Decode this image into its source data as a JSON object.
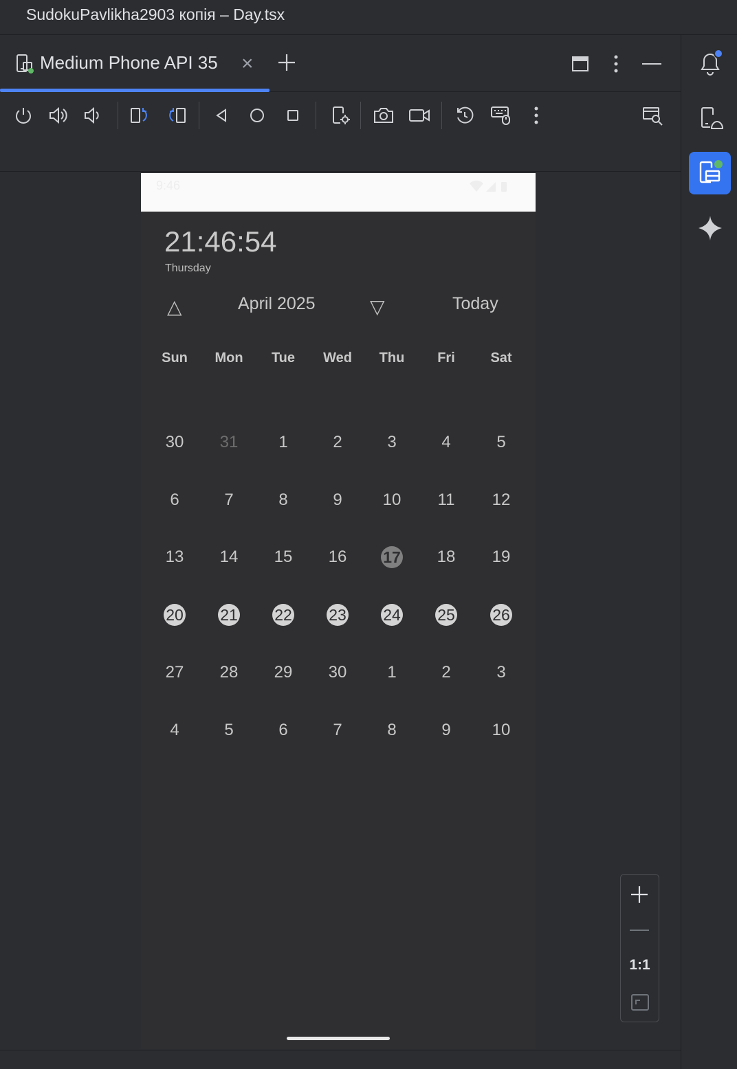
{
  "window": {
    "title": "SudokuPavlikha2903 копія – Day.tsx"
  },
  "tabs": [
    {
      "label": "Medium Phone API 35",
      "close": "×"
    }
  ],
  "phone": {
    "status_time": "9:46",
    "clock": "21:46:54",
    "weekday": "Thursday",
    "prev_symbol": "△",
    "month_label": "April 2025",
    "next_symbol": "▽",
    "today_label": "Today",
    "weekdays": [
      "Sun",
      "Mon",
      "Tue",
      "Wed",
      "Thu",
      "Fri",
      "Sat"
    ],
    "weeks": [
      [
        "30",
        "31",
        "1",
        "2",
        "3",
        "4",
        "5"
      ],
      [
        "6",
        "7",
        "8",
        "9",
        "10",
        "11",
        "12"
      ],
      [
        "13",
        "14",
        "15",
        "16",
        "17",
        "18",
        "19"
      ],
      [
        "20",
        "21",
        "22",
        "23",
        "24",
        "25",
        "26"
      ],
      [
        "27",
        "28",
        "29",
        "30",
        "1",
        "2",
        "3"
      ],
      [
        "4",
        "5",
        "6",
        "7",
        "8",
        "9",
        "10"
      ]
    ],
    "today_day": "17",
    "selected_week": [
      "20",
      "21",
      "22",
      "23",
      "24",
      "25",
      "26"
    ]
  },
  "zoom": {
    "ratio_label": "1:1"
  },
  "colors": {
    "accent": "#4e83f6",
    "selected_bg": "#d4d4d4",
    "today_bg": "#808080"
  }
}
